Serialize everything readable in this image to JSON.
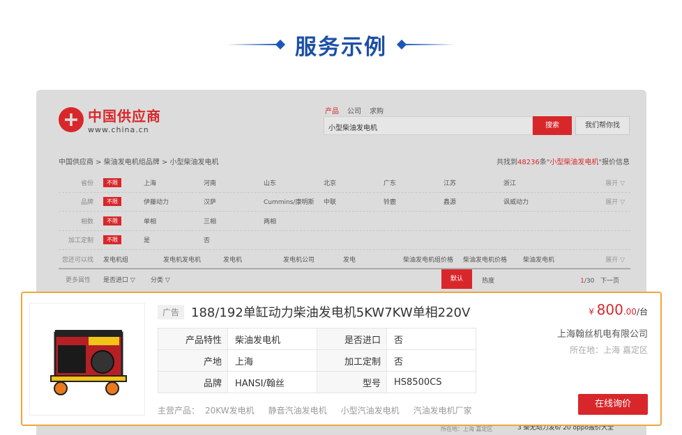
{
  "heading": "服务示例",
  "colors": {
    "accent": "#d8272b",
    "heading": "#1b4fa6",
    "highlight": "#f0a43a"
  },
  "site": {
    "logo_name": "中国供应商",
    "logo_url": "www.china.cn"
  },
  "search": {
    "tabs": [
      "产品",
      "公司",
      "求购"
    ],
    "query": "小型柴油发电机",
    "button": "搜索",
    "help_button": "我们帮你找"
  },
  "breadcrumb": "中国供应商 >  柴油发电机组品牌 >  小型柴油发电机",
  "results": {
    "prefix": "共找到",
    "count": "48236",
    "mid": "条\"",
    "keyword": "小型柴油发电机",
    "suffix": "\"报价信息"
  },
  "filters": [
    {
      "label": "省份",
      "tag": "不限",
      "values": [
        "上海",
        "河南",
        "山东",
        "北京",
        "广东",
        "江苏",
        "浙江"
      ],
      "more": "展开 ▽"
    },
    {
      "label": "品牌",
      "tag": "不限",
      "values": [
        "伊藤动力",
        "汉萨",
        "Cummins/康明斯",
        "中联",
        "铃鹿",
        "鑫源",
        "讽威动力"
      ],
      "more": "展开 ▽"
    },
    {
      "label": "相数",
      "tag": "不限",
      "values": [
        "单相",
        "三相",
        "两相"
      ],
      "more": ""
    },
    {
      "label": "加工定制",
      "tag": "不限",
      "values": [
        "是",
        "否"
      ],
      "more": ""
    },
    {
      "label": "您还可以找",
      "tag": "",
      "values": [
        "发电机组",
        "发电机发电机",
        "发电机",
        "发电机公司",
        "发电",
        "柴油发电机组价格",
        "柴油发电机价格",
        "柴油发电机"
      ],
      "more": "展开 ▽"
    }
  ],
  "sortbar": {
    "label": "更多属性",
    "opt1": "是否进口 ▽",
    "opt2": "分类 ▽",
    "default": "默认",
    "hot": "热度",
    "page_current": "1",
    "page_total": "/30",
    "next": "下一页"
  },
  "behind": {
    "location": "所在地：上海 嘉定区",
    "rank": "3  柴无动力发6/    20 oppo报价大全"
  },
  "product": {
    "ad_label": "广告",
    "title": "188/192单缸动力柴油发电机5KW7KW单相220V",
    "price_symbol": "¥",
    "price_int": "800",
    "price_dec": ".00",
    "price_unit": "/台",
    "company": "上海翰丝机电有限公司",
    "location": "所在地：上海 嘉定区",
    "inquiry_button": "在线询价",
    "specs": [
      {
        "k1": "产品特性",
        "v1": "柴油发电机",
        "k2": "是否进口",
        "v2": "否"
      },
      {
        "k1": "产地",
        "v1": "上海",
        "k2": "加工定制",
        "v2": "否"
      },
      {
        "k1": "品牌",
        "v1": "HANSI/翰丝",
        "k2": "型号",
        "v2": "HS8500CS"
      }
    ],
    "main_label": "主营产品：",
    "main_products": [
      "20KW发电机",
      "静音汽油发电机",
      "小型汽油发电机",
      "汽油发电机厂家"
    ]
  }
}
